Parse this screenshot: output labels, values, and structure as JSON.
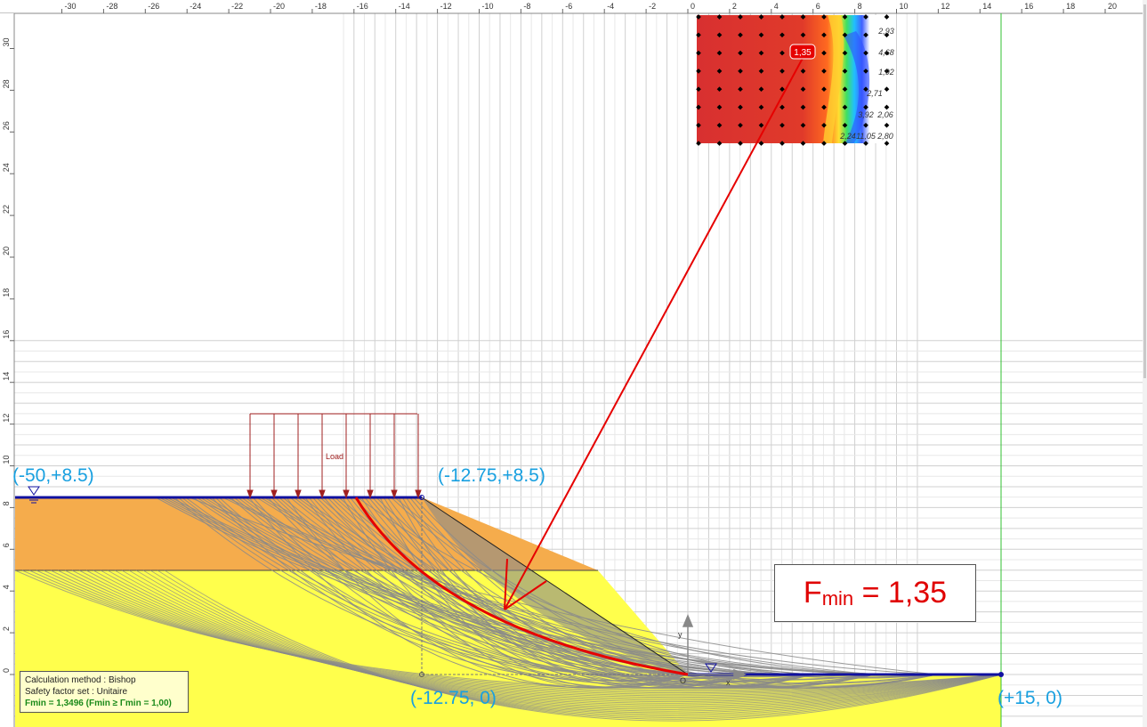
{
  "canvas": {
    "x_ticks": [
      "-30",
      "-28",
      "-26",
      "-24",
      "-22",
      "-20",
      "-18",
      "-16",
      "-14",
      "-12",
      "-10",
      "-8",
      "-6",
      "-4",
      "-2",
      "0",
      "2",
      "4",
      "6",
      "8",
      "10",
      "12",
      "14",
      "16",
      "18",
      "20"
    ],
    "y_ticks": [
      "0",
      "2",
      "4",
      "6",
      "8",
      "10",
      "12",
      "14",
      "16",
      "18",
      "20",
      "22",
      "24",
      "26",
      "28",
      "30"
    ]
  },
  "coords": {
    "top_left": "(-50,+8.5)",
    "crest": "(-12.75,+8.5)",
    "toe": "(-12.75, 0)",
    "right": "(+15, 0)"
  },
  "load_label": "Load",
  "grid_map": {
    "fmin_tag": "1,35",
    "visible_values": [
      "2,93",
      "4,68",
      "1,92",
      "2,71",
      "2,06",
      "3,92",
      "2,24",
      "11,05",
      "2,80"
    ]
  },
  "fmin_box": {
    "F": "F",
    "sub": "min",
    "rest": " = 1,35"
  },
  "calc_box": {
    "method": "Calculation method : Bishop",
    "safety": "Safety factor set : Unitaire",
    "fmin": "Fmin = 1,3496 (Fmin ≥ Γmin = 1,00)"
  },
  "colors": {
    "layer_top": "#f5ac4c",
    "layer_bottom": "#ffff4c",
    "slip_surface": "#e60000",
    "coord_text": "#18a0e0",
    "crest_line": "#1010a0",
    "load_arrows": "#a02020"
  }
}
